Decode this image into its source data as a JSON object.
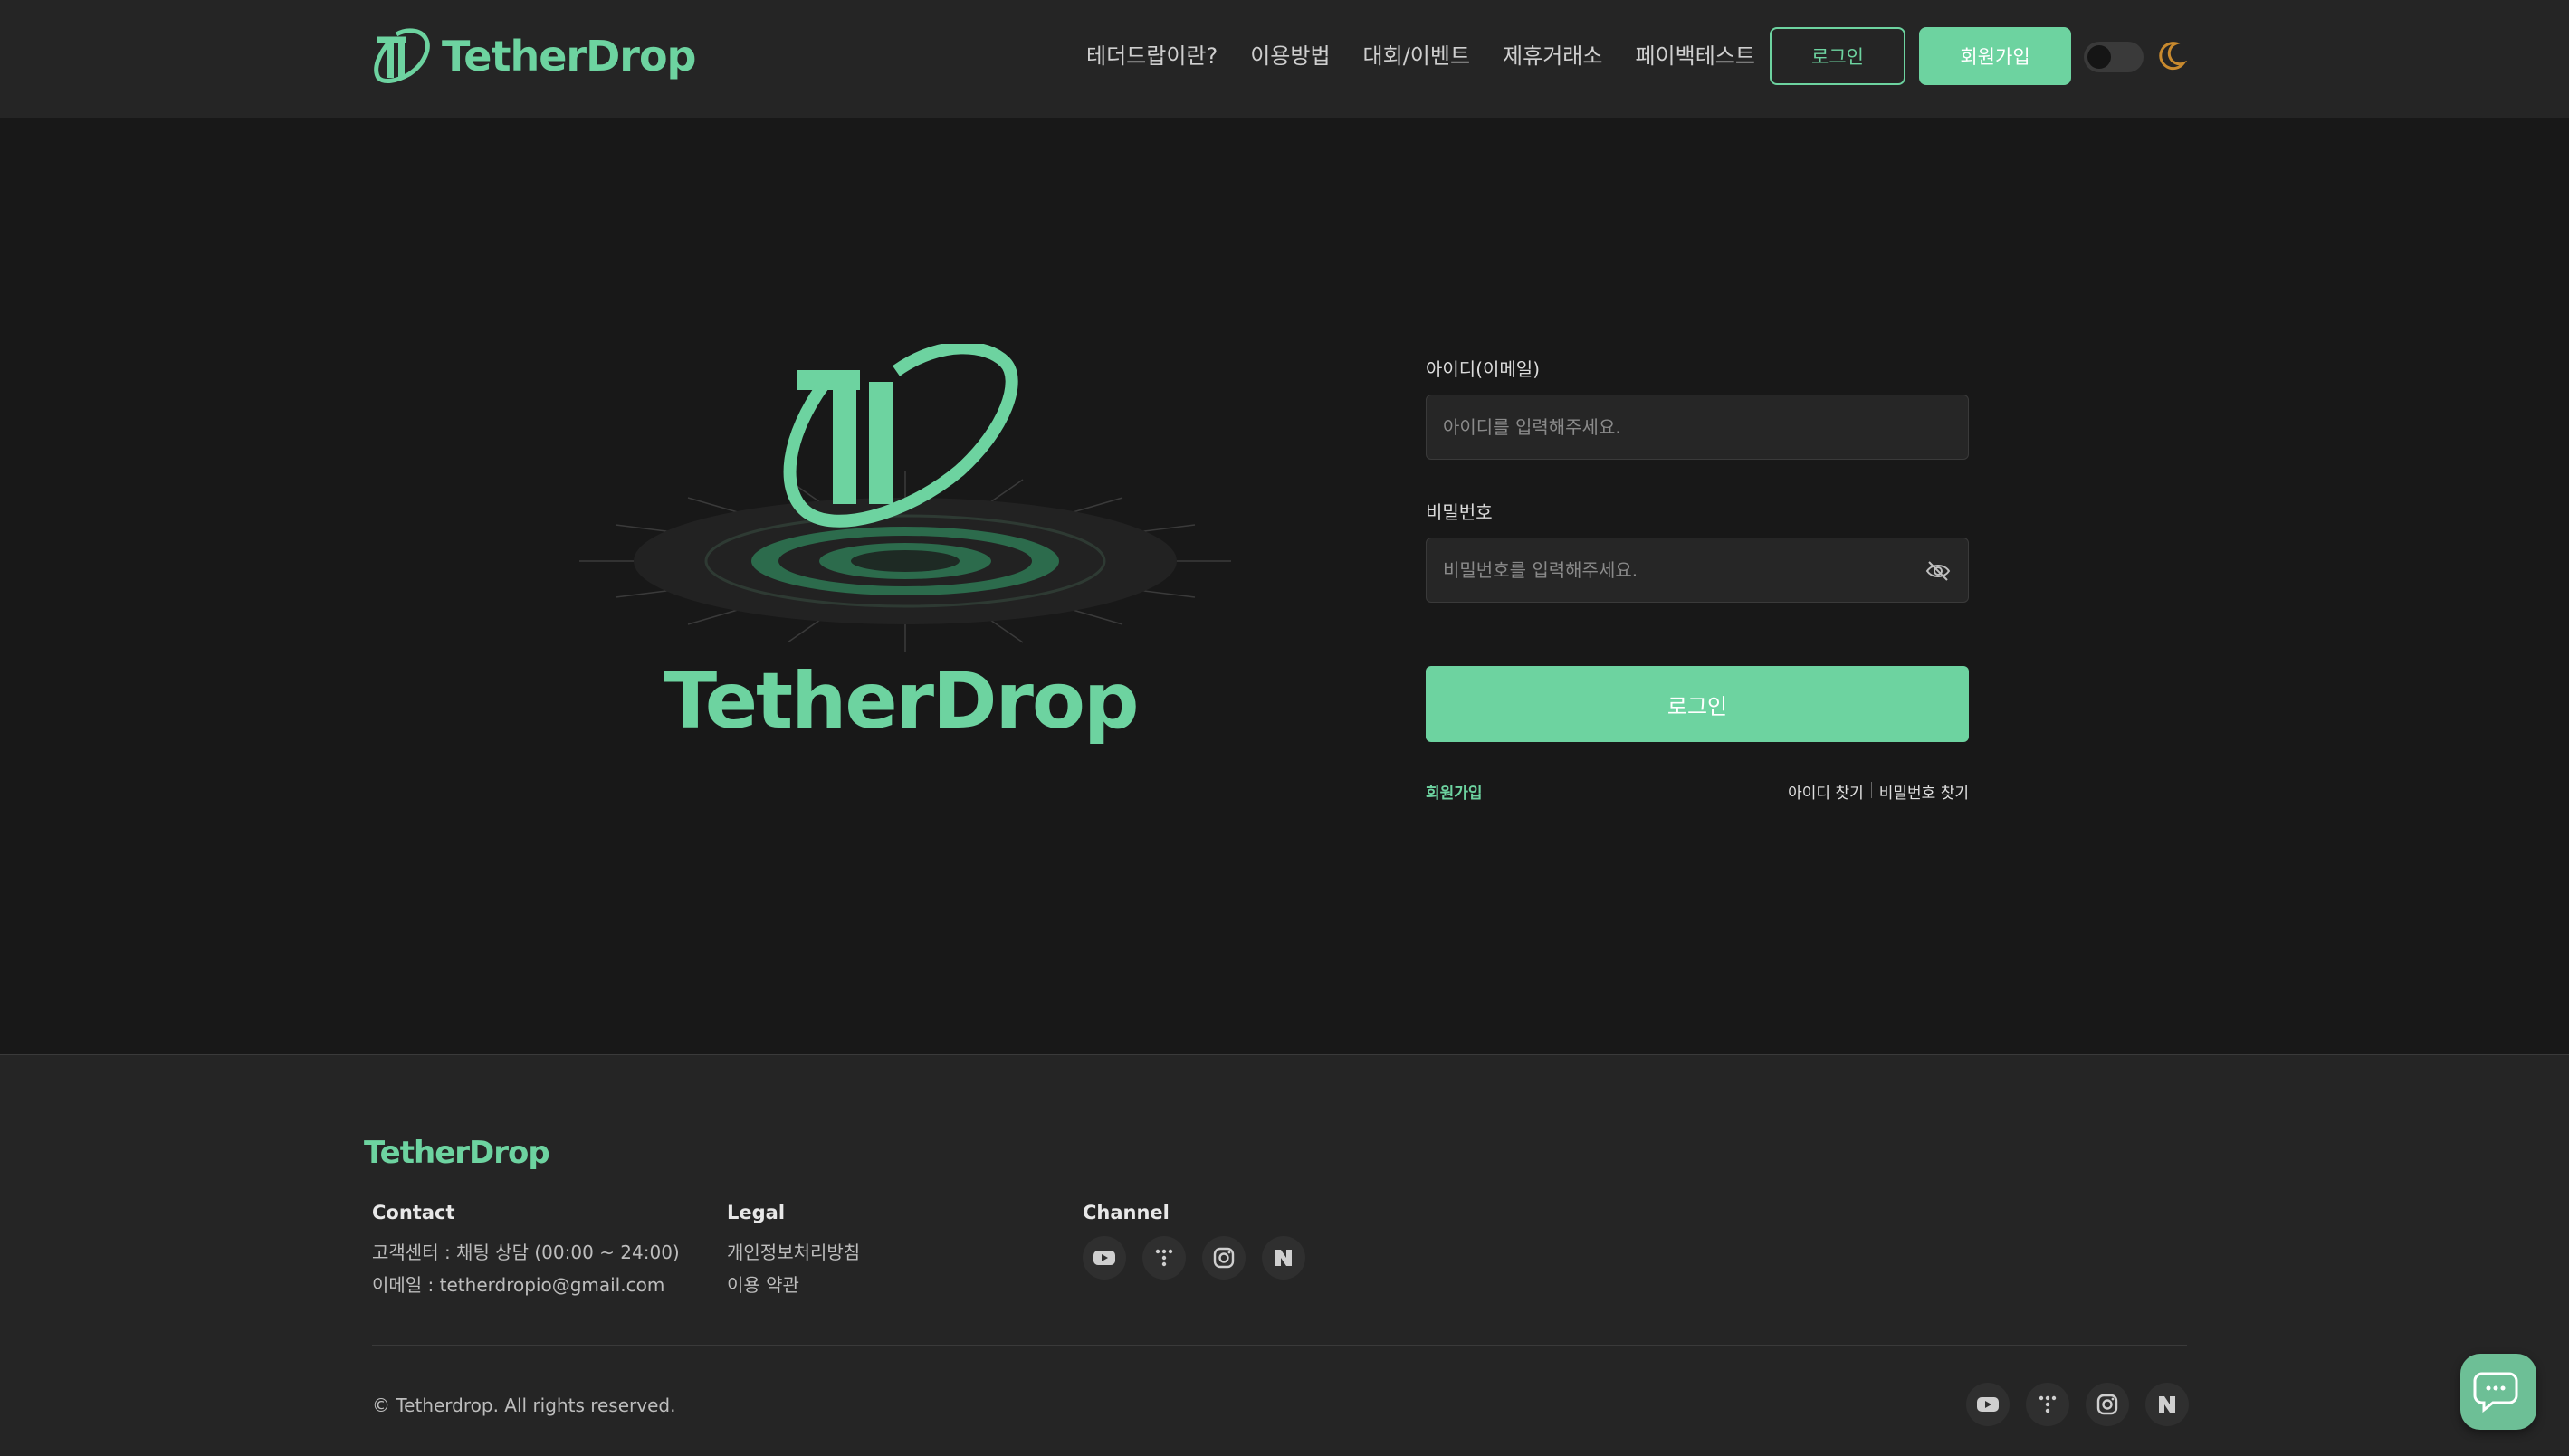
{
  "header": {
    "brand": "TetherDrop",
    "nav": [
      "테더드랍이란?",
      "이용방법",
      "대회/이벤트",
      "제휴거래소",
      "페이백테스트"
    ],
    "login_label": "로그인",
    "signup_label": "회원가입",
    "theme_icon": "moon-icon"
  },
  "hero": {
    "brand": "TetherDrop"
  },
  "form": {
    "id_label": "아이디(이메일)",
    "id_placeholder": "아이디를 입력해주세요.",
    "pw_label": "비밀번호",
    "pw_placeholder": "비밀번호를 입력해주세요.",
    "submit_label": "로그인",
    "signup_link": "회원가입",
    "find_id": "아이디 찾기",
    "find_pw": "비밀번호 찾기"
  },
  "footer": {
    "brand": "TetherDrop",
    "contact_title": "Contact",
    "contact_lines": [
      "고객센터 : 채팅 상담 (00:00 ~ 24:00)",
      "이메일 : tetherdropio@gmail.com"
    ],
    "legal_title": "Legal",
    "legal_lines": [
      "개인정보처리방침",
      "이용 약관"
    ],
    "channel_title": "Channel",
    "channels": [
      "youtube-icon",
      "dots-icon",
      "instagram-icon",
      "naver-icon"
    ],
    "copyright": "© Tetherdrop. All rights reserved."
  },
  "colors": {
    "accent": "#6dd3a0",
    "background": "#181818",
    "header": "#252525"
  }
}
